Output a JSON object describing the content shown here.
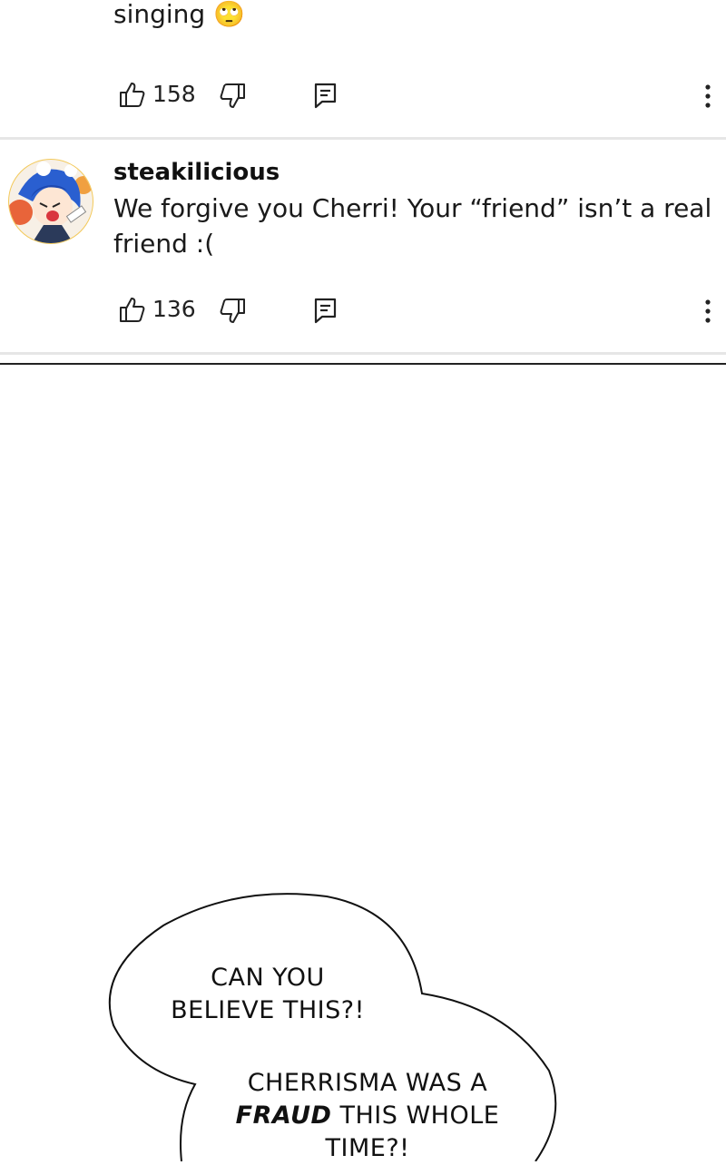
{
  "comments": [
    {
      "text_tail": "singing",
      "emoji": "🙄",
      "likes": "158"
    },
    {
      "username": "steakilicious",
      "text_line1": "We forgive you Cherri! Your “friend” isn’t a real",
      "text_line2": "friend :(",
      "likes": "136"
    }
  ],
  "comic": {
    "bubble1_line1": "CAN YOU",
    "bubble1_line2": "BELIEVE THIS?!",
    "bubble2_line1": "CHERRISMA WAS A",
    "bubble2_emph": "FRAUD",
    "bubble2_line2_rest": " THIS WHOLE",
    "bubble2_line3": "TIME?!"
  },
  "colors": {
    "divider": "#e6e6e6",
    "panel_border": "#222222",
    "avatar_blue": "#2a5fd0"
  },
  "icons": [
    "thumbs-up-icon",
    "thumbs-down-icon",
    "reply-comment-icon",
    "more-vertical-icon"
  ]
}
